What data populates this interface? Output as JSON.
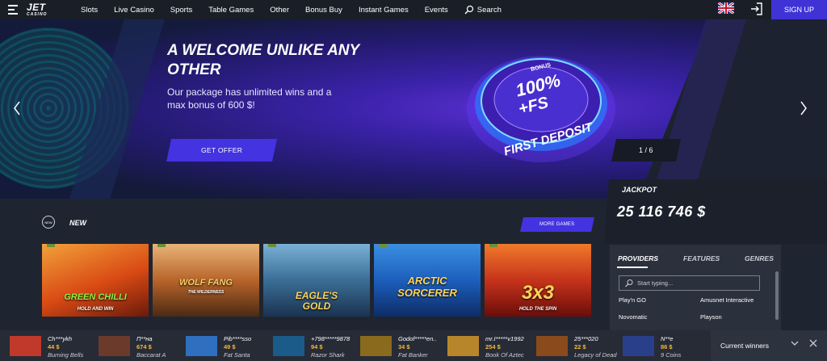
{
  "header": {
    "logo": "JET",
    "logo_sub": "CASINO",
    "nav": [
      "Slots",
      "Live Casino",
      "Sports",
      "Table Games",
      "Other",
      "Bonus Buy",
      "Instant Games",
      "Events"
    ],
    "search_label": "Search",
    "signup_label": "SIGN UP"
  },
  "hero": {
    "title": "A WELCOME UNLIKE ANY OTHER",
    "subtitle": "Our package has unlimited wins and a max bonus of 600 $!",
    "cta_label": "GET OFFER",
    "badge_top": "BONUS",
    "badge_main": "100%",
    "badge_fs": "+FS",
    "badge_bottom": "FIRST DEPOSIT",
    "slide_counter": "1 / 6"
  },
  "jackpot": {
    "label": "JACKPOT",
    "value": "25 116 746 $"
  },
  "new_games": {
    "icon_text": "NEW",
    "title": "NEW",
    "more_label": "MORE GAMES",
    "tiles": [
      {
        "name": "GREEN CHILLI",
        "sub": "HOLD AND WIN",
        "color": "#d94a14"
      },
      {
        "name": "WOLF FANG",
        "sub": "THE WILDERNESS",
        "color": "#b8642a"
      },
      {
        "name": "EAGLE'S GOLD",
        "sub": "",
        "color": "#3b6e96"
      },
      {
        "name": "ARCTIC SORCERER",
        "sub": "",
        "color": "#1c5fbd"
      },
      {
        "name": "3x3",
        "sub": "HOLD THE SPIN",
        "color": "#c6331b"
      }
    ]
  },
  "providers_panel": {
    "tabs": [
      "PROVIDERS",
      "FEATURES",
      "GENRES"
    ],
    "search_placeholder": "Start typing...",
    "providers": [
      "Play'n GO",
      "Amusnet Interactive",
      "Novomatic",
      "Playson"
    ]
  },
  "winners": {
    "items": [
      {
        "name": "Ch***ykh",
        "amount": "44 $",
        "game": "Burning Bells",
        "color": "#c0392b"
      },
      {
        "name": "П**на",
        "amount": "674 $",
        "game": "Baccarat A",
        "color": "#6b3a2a"
      },
      {
        "name": "Pib****sso",
        "amount": "49 $",
        "game": "Fat Santa",
        "color": "#2f6fbf"
      },
      {
        "name": "+798*****9878",
        "amount": "94 $",
        "game": "Razor Shark",
        "color": "#1a5b8a"
      },
      {
        "name": "Godof*****en..",
        "amount": "34 $",
        "game": "Fat Banker",
        "color": "#8a6a1c"
      },
      {
        "name": "mr.I*****v1992",
        "amount": "254 $",
        "game": "Book Of Aztec",
        "color": "#b8862a"
      },
      {
        "name": "25***020",
        "amount": "22 $",
        "game": "Legacy of Dead",
        "color": "#8a4a1c"
      },
      {
        "name": "N**e",
        "amount": "86 $",
        "game": "9 Coins",
        "color": "#2a3f8a"
      }
    ],
    "current_label": "Current winners"
  }
}
